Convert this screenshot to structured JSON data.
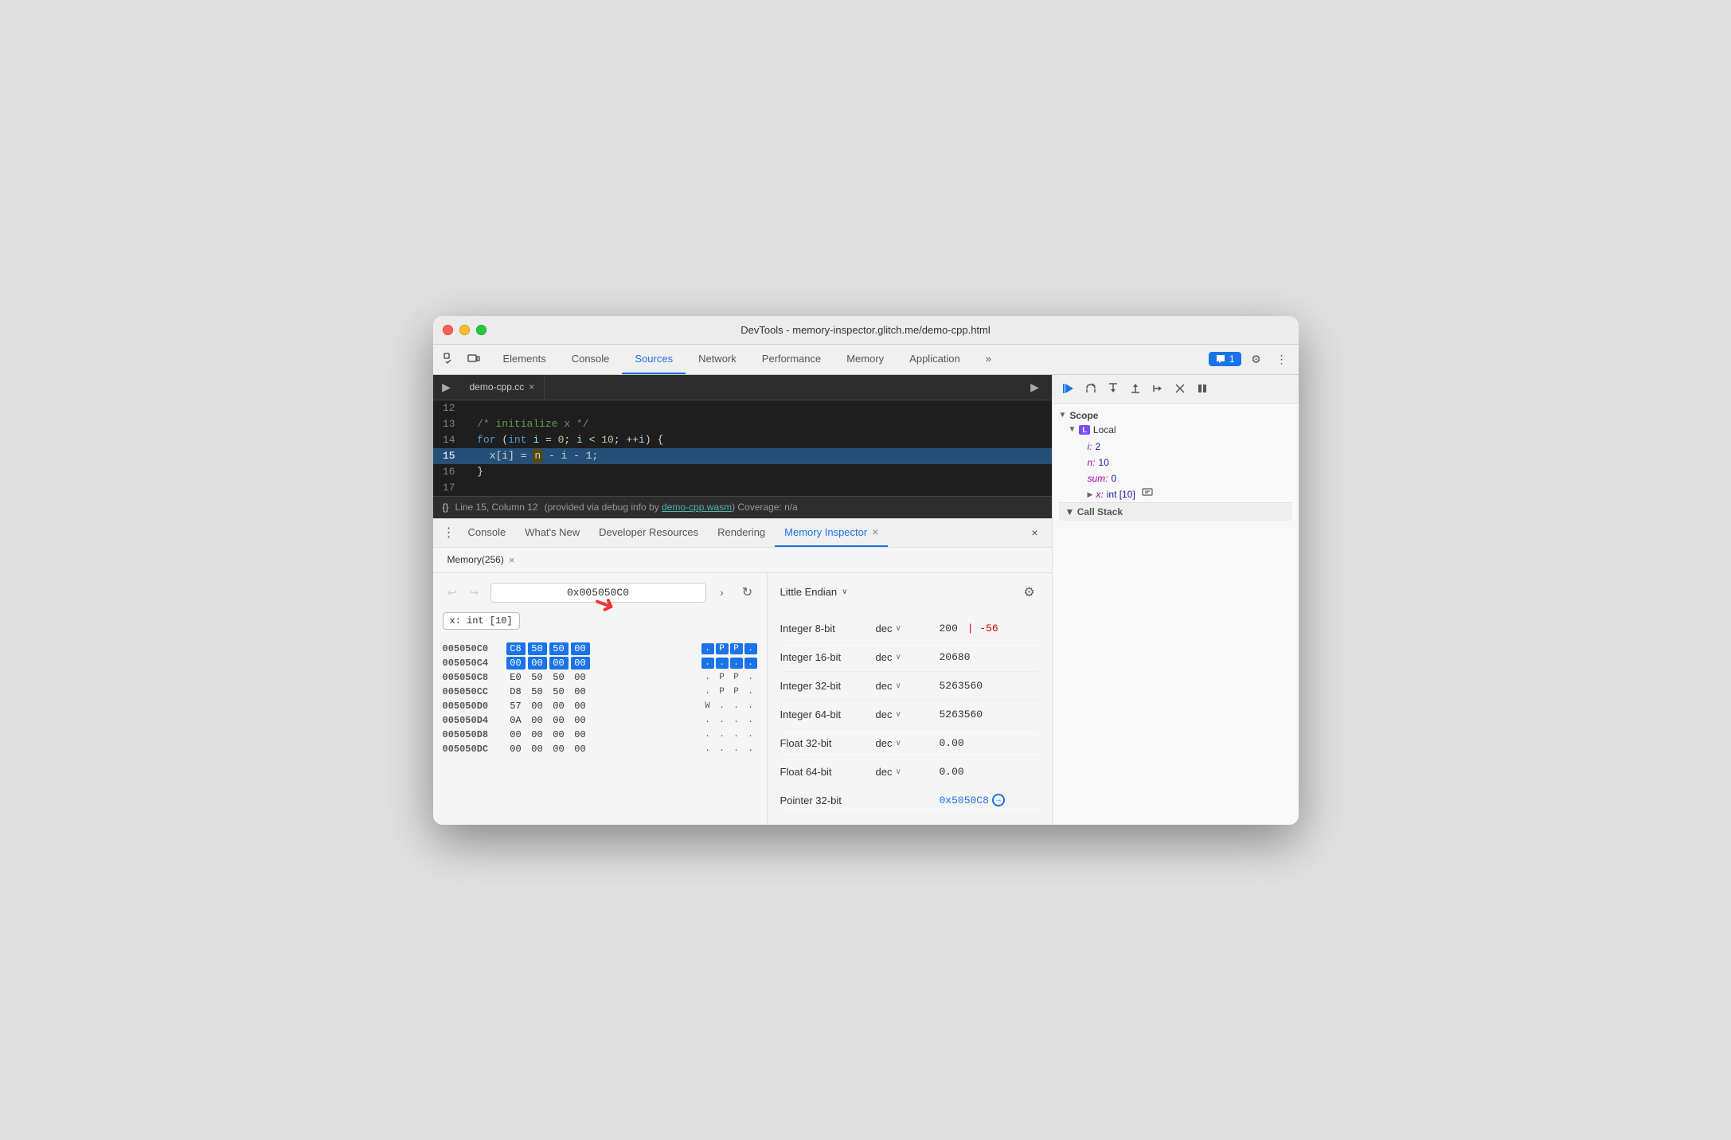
{
  "window": {
    "title": "DevTools - memory-inspector.glitch.me/demo-cpp.html"
  },
  "top_tabs": {
    "items": [
      {
        "label": "Elements",
        "active": false
      },
      {
        "label": "Console",
        "active": false
      },
      {
        "label": "Sources",
        "active": true
      },
      {
        "label": "Network",
        "active": false
      },
      {
        "label": "Performance",
        "active": false
      },
      {
        "label": "Memory",
        "active": false
      },
      {
        "label": "Application",
        "active": false
      }
    ],
    "more_icon": "»",
    "badge": "1",
    "settings_icon": "⚙",
    "more_vertical_icon": "⋮"
  },
  "source_tab": {
    "file_name": "demo-cpp.cc",
    "close_icon": "×"
  },
  "code_lines": [
    {
      "num": "12",
      "content": "",
      "active": false
    },
    {
      "num": "13",
      "content": "  /* initialize x */",
      "active": false
    },
    {
      "num": "14",
      "content": "  for (int i = 0; i < 10; ++i) {",
      "active": false
    },
    {
      "num": "15",
      "content": "    x[i] = n - i - 1;",
      "active": true
    },
    {
      "num": "16",
      "content": "  }",
      "active": false
    },
    {
      "num": "17",
      "content": "",
      "active": false
    }
  ],
  "status_bar": {
    "cursor_icon": "{}",
    "position": "Line 15, Column 12",
    "debug_info": "(provided via debug info by",
    "wasm_link": "demo-cpp.wasm",
    "coverage": ") Coverage: n/a"
  },
  "debug_toolbar": {
    "resume_icon": "▶",
    "step_over_icon": "↷",
    "step_into_icon": "↓",
    "step_out_icon": "↑",
    "step_icon": "→",
    "deactivate_icon": "/",
    "pause_icon": "⏸"
  },
  "scope": {
    "header": "Scope",
    "local_badge": "L",
    "local_label": "Local",
    "vars": [
      {
        "name": "i:",
        "value": "2",
        "highlight": false
      },
      {
        "name": "n:",
        "value": "10",
        "highlight": false
      },
      {
        "name": "sum:",
        "value": "0",
        "highlight": false
      },
      {
        "name": "x:",
        "value": "int [10]",
        "has_memory_icon": true,
        "highlight": false
      }
    ],
    "call_stack_header": "▼ Call Stack"
  },
  "bottom_tabs": {
    "more_icon": "⋮",
    "items": [
      {
        "label": "Console",
        "active": false
      },
      {
        "label": "What's New",
        "active": false
      },
      {
        "label": "Developer Resources",
        "active": false
      },
      {
        "label": "Rendering",
        "active": false
      },
      {
        "label": "Memory Inspector",
        "active": true
      }
    ],
    "close_icon": "×",
    "panel_close_icon": "×"
  },
  "memory_tab": {
    "label": "Memory(256)",
    "close_icon": "×"
  },
  "address_bar": {
    "back_icon": "↩",
    "forward_icon": "↪",
    "address": "0x005050C0",
    "arrow_icon": ">",
    "refresh_icon": "↻"
  },
  "var_tag": {
    "label": "x: int [10]"
  },
  "hex_rows": [
    {
      "addr": "005050C0",
      "bytes": [
        "C8",
        "50",
        "50",
        "00"
      ],
      "selected": [
        true,
        true,
        true,
        true
      ],
      "ascii": [
        ".",
        "P",
        "P",
        "."
      ],
      "ascii_selected": [
        true,
        true,
        true,
        true
      ]
    },
    {
      "addr": "005050C4",
      "bytes": [
        "00",
        "00",
        "00",
        "00"
      ],
      "selected": [
        true,
        true,
        true,
        true
      ],
      "ascii": [
        ".",
        ".",
        ".",
        "."
      ],
      "ascii_selected": [
        true,
        true,
        true,
        true
      ]
    },
    {
      "addr": "005050C8",
      "bytes": [
        "E0",
        "50",
        "50",
        "00"
      ],
      "selected": [
        false,
        false,
        false,
        false
      ],
      "ascii": [
        ".",
        "P",
        "P",
        "."
      ],
      "ascii_selected": [
        false,
        false,
        false,
        false
      ]
    },
    {
      "addr": "005050CC",
      "bytes": [
        "D8",
        "50",
        "50",
        "00"
      ],
      "selected": [
        false,
        false,
        false,
        false
      ],
      "ascii": [
        ".",
        "P",
        "P",
        "."
      ],
      "ascii_selected": [
        false,
        false,
        false,
        false
      ]
    },
    {
      "addr": "005050D0",
      "bytes": [
        "57",
        "00",
        "00",
        "00"
      ],
      "selected": [
        false,
        false,
        false,
        false
      ],
      "ascii": [
        "W",
        ".",
        ".",
        "."
      ],
      "ascii_selected": [
        false,
        false,
        false,
        false
      ]
    },
    {
      "addr": "005050D4",
      "bytes": [
        "0A",
        "00",
        "00",
        "00"
      ],
      "selected": [
        false,
        false,
        false,
        false
      ],
      "ascii": [
        ".",
        ".",
        ".",
        "."
      ],
      "ascii_selected": [
        false,
        false,
        false,
        false
      ]
    },
    {
      "addr": "005050D8",
      "bytes": [
        "00",
        "00",
        "00",
        "00"
      ],
      "selected": [
        false,
        false,
        false,
        false
      ],
      "ascii": [
        ".",
        ".",
        ".",
        "."
      ],
      "ascii_selected": [
        false,
        false,
        false,
        false
      ]
    },
    {
      "addr": "005050DC",
      "bytes": [
        "00",
        "00",
        "00",
        "00"
      ],
      "selected": [
        false,
        false,
        false,
        false
      ],
      "ascii": [
        ".",
        ".",
        ".",
        "."
      ],
      "ascii_selected": [
        false,
        false,
        false,
        false
      ]
    }
  ],
  "endian": {
    "label": "Little Endian",
    "chevron": "∨"
  },
  "data_types": [
    {
      "label": "Integer 8-bit",
      "format": "dec",
      "value": "200",
      "negative": "-56",
      "show_separator": true
    },
    {
      "label": "Integer 16-bit",
      "format": "dec",
      "value": "20680",
      "negative": null
    },
    {
      "label": "Integer 32-bit",
      "format": "dec",
      "value": "5263560",
      "negative": null
    },
    {
      "label": "Integer 64-bit",
      "format": "dec",
      "value": "5263560",
      "negative": null
    },
    {
      "label": "Float 32-bit",
      "format": "dec",
      "value": "0.00",
      "negative": null
    },
    {
      "label": "Float 64-bit",
      "format": "dec",
      "value": "0.00",
      "negative": null
    },
    {
      "label": "Pointer 32-bit",
      "format": null,
      "value": "0x5050C8",
      "is_pointer": true
    }
  ]
}
